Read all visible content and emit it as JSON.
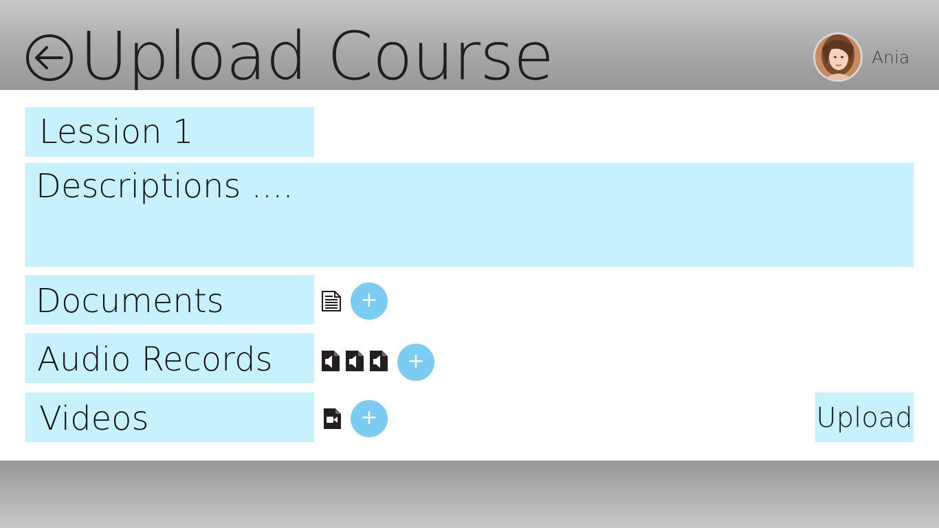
{
  "header": {
    "title": "Upload Course",
    "back_icon": "back-arrow-circle-icon",
    "user": {
      "name": "Ania",
      "avatar_icon": "user-avatar"
    }
  },
  "form": {
    "lesson_title": "Lession 1",
    "description": "Descriptions ....",
    "sections": {
      "documents": {
        "label": "Documents",
        "file_icon": "document-icon",
        "file_count": 1,
        "add_label": "+"
      },
      "audio": {
        "label": "Audio Records",
        "file_icon": "audio-file-icon",
        "file_count": 3,
        "add_label": "+"
      },
      "videos": {
        "label": "Videos",
        "file_icon": "video-file-icon",
        "file_count": 1,
        "add_label": "+"
      }
    },
    "upload_label": "Upload"
  },
  "colors": {
    "field_background": "#c7f1fd",
    "add_button": "#7ccbf0",
    "header_gray": "#a9a9a9",
    "text": "#141414"
  }
}
